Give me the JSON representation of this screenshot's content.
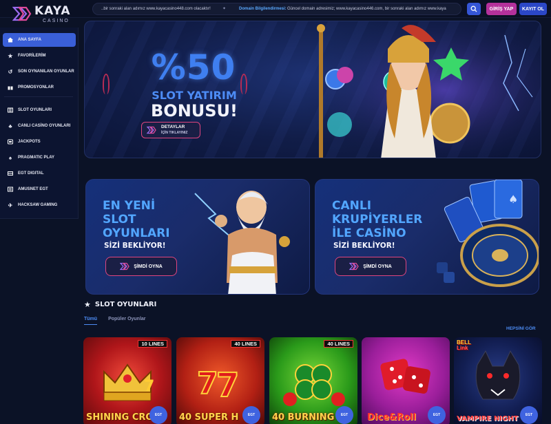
{
  "brand": {
    "name": "KAYA",
    "sub": "CASINO"
  },
  "ticker": {
    "text1": "..bir sonraki alan adımız www.kayacasino448.com olacaktır!",
    "text2": "Domain Bilgilendirmesi:",
    "text3": "Güncel domain adresimiz; www.kayacasino446.com, bir sonraki alan adımız www.kaya"
  },
  "header": {
    "login": "GİRİŞ YAP",
    "register": "KAYIT OL"
  },
  "sidebar": {
    "items": [
      {
        "label": "ANA SAYFA",
        "icon": "home-icon"
      },
      {
        "label": "FAVORİLERİM",
        "icon": "star-icon"
      },
      {
        "label": "SON OYNANILAN OYUNLAR",
        "icon": "history-icon"
      },
      {
        "label": "PROMOSYONLAR",
        "icon": "gift-icon"
      },
      {
        "label": "SLOT OYUNLARI",
        "icon": "slot-icon"
      },
      {
        "label": "CANLI CASİNO OYUNLARI",
        "icon": "cards-icon"
      },
      {
        "label": "JACKPOTS",
        "icon": "jackpot-icon"
      },
      {
        "label": "PRAGMATIC PLAY",
        "icon": "pragmatic-icon"
      },
      {
        "label": "EGT DIGITAL",
        "icon": "egt-icon"
      },
      {
        "label": "AMUSNET EGT",
        "icon": "amusnet-icon"
      },
      {
        "label": "HACKSAW GAMING",
        "icon": "hacksaw-icon"
      }
    ]
  },
  "hero": {
    "percent": "%50",
    "line1": "SLOT YATIRIM",
    "line2": "BONUSU!",
    "cta_title": "DETAYLAR",
    "cta_sub": "İÇİN TIKLAYINIZ"
  },
  "promos": [
    {
      "title": [
        "EN YENİ",
        "SLOT",
        "OYUNLARI"
      ],
      "sub": "SİZİ BEKLİYOR!",
      "cta": "ŞİMDİ OYNA"
    },
    {
      "title": [
        "CANLI",
        "KRUPİYERLER",
        "İLE CASİNO"
      ],
      "sub": "SİZİ BEKLİYOR!",
      "cta": "ŞİMDİ OYNA"
    }
  ],
  "slots_section": {
    "title": "SLOT OYUNLARI",
    "tabs": [
      "Tümü",
      "Popüler Oyunlar"
    ],
    "see_all": "HEPSİNİ GÖR",
    "games": [
      {
        "name": "SHINING CRO",
        "lines": "10 LINES",
        "provider": "EGT"
      },
      {
        "name": "40 SUPER H",
        "lines": "40 LINES",
        "provider": "EGT"
      },
      {
        "name": "40 BURNING",
        "lines": "40 LINES",
        "provider": "EGT"
      },
      {
        "name": "Dice&Roll",
        "lines": "",
        "provider": "EGT"
      },
      {
        "name": "VAMPIRE NIGHT",
        "lines": "",
        "provider": "EGT",
        "badge": "BELL LINK"
      }
    ]
  },
  "colors": {
    "accent": "#3a5fd8",
    "pink": "#b4319b",
    "bg": "#0b1226"
  }
}
